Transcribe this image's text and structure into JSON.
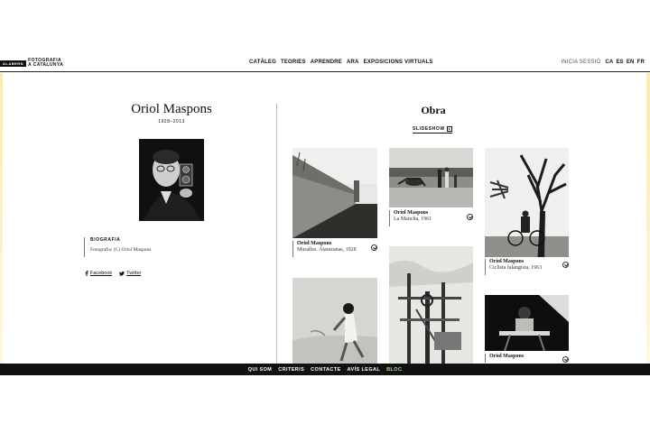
{
  "header": {
    "logo_box": "ALABERN",
    "logo_line1": "FOTOGRAFIA",
    "logo_line2": "A CATALUNYA",
    "nav": [
      "CATÀLEG",
      "TEORIES",
      "APRENDRE",
      "ARA",
      "EXPOSICIONS VIRTUALS"
    ],
    "login": "INICIA SESSIÓ",
    "languages": [
      "CA",
      "ES",
      "EN",
      "FR"
    ]
  },
  "artist": {
    "name": "Oriol Maspons",
    "dates": "1928–2013",
    "bio_heading": "BIOGRAFIA",
    "photo_credit": "Fotografia: (C) Oriol Maspons"
  },
  "social": {
    "facebook": "Facebook",
    "twitter": "Twitter"
  },
  "obra": {
    "title": "Obra",
    "slideshow_label": "SLIDESHOW"
  },
  "works": [
    {
      "author": "Oriol Maspons",
      "title": "Muralles. Atarazanas, 1928"
    },
    {
      "author": "Oriol Maspons",
      "title": "La Mancha, 1961"
    },
    {
      "author": "Oriol Maspons",
      "title": "Ciclista falangista, 1963"
    },
    {
      "author": "Oriol Maspons",
      "title": ""
    }
  ],
  "footer": [
    "QUI SOM",
    "CRITERIS",
    "CONTACTE",
    "AVÍS LEGAL",
    "BLOC"
  ],
  "colors": {
    "accent_bloc": "#a7e08a",
    "edge_glow": "#f7ecb4",
    "footer_bg": "#111111"
  }
}
